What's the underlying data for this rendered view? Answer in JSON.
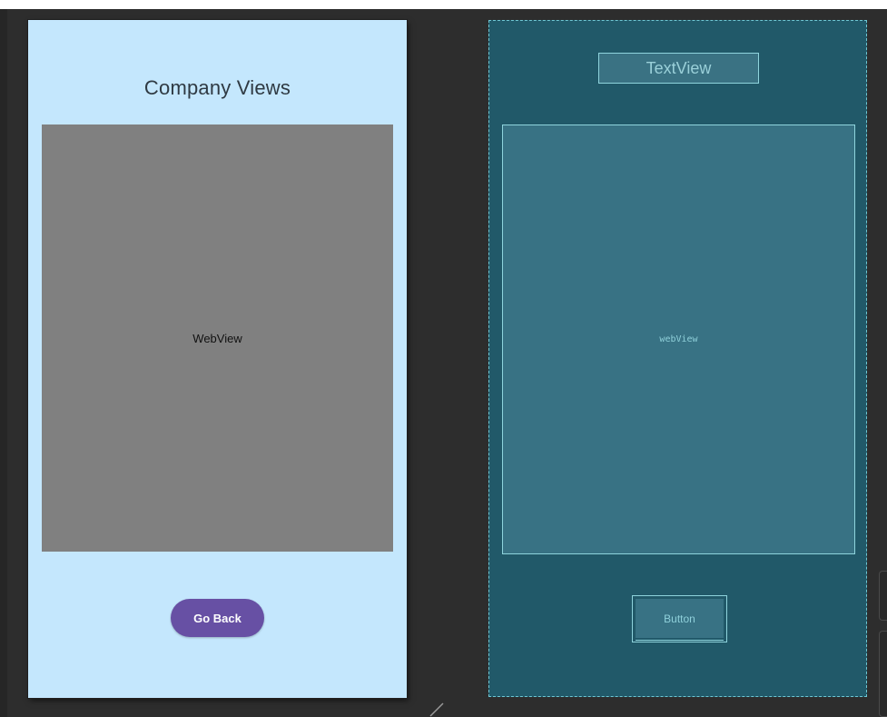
{
  "design": {
    "title": "Company Views",
    "webview_label": "WebView",
    "button_label": "Go Back"
  },
  "blueprint": {
    "textview_label": "TextView",
    "webview_label": "webView",
    "button_label": "Button"
  },
  "colors": {
    "design_background": "#c4e7fd",
    "webview_placeholder": "#808080",
    "button_primary": "#6750a4",
    "blueprint_background": "#215969",
    "blueprint_outline": "#8fd4dd"
  },
  "icons": {
    "resize_handle": "resize-handle-icon"
  }
}
